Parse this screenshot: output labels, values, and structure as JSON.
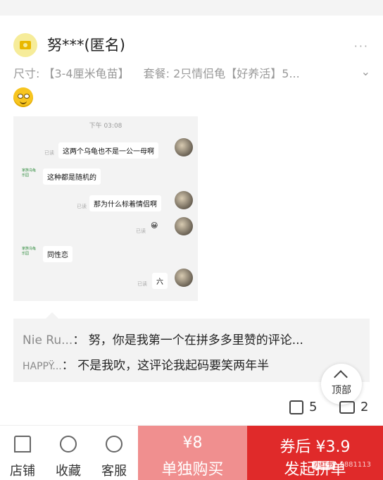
{
  "review": {
    "username": "努***(匿名)",
    "more": "···",
    "spec_size": "尺寸: 【3-4厘米龟苗】",
    "spec_package": "套餐: 2只情侣龟【好养活】5...",
    "emoji": "smiling-face-emoji",
    "screenshot": {
      "time": "下午 03:08",
      "messages": [
        {
          "side": "right",
          "text": "这两个乌龟也不是一公一母啊",
          "read": "已读"
        },
        {
          "side": "left",
          "text": "这种都是随机的",
          "shop": "家族乌龟乐园"
        },
        {
          "side": "right",
          "text": "那为什么标着情侣啊",
          "read": "已读"
        },
        {
          "side": "right",
          "text": "😀",
          "read": "已读"
        },
        {
          "side": "left",
          "text": "同性恋",
          "shop": "家族乌龟乐园"
        },
        {
          "side": "right",
          "text": "六",
          "read": "已读"
        }
      ]
    }
  },
  "replies": [
    {
      "name": "Nie Ru...",
      "text": "努，你是我第一个在拼多多里赞的评论..."
    },
    {
      "name": "HAPPŸ...",
      "text": "不是我吹，这评论我起码要笑两年半"
    }
  ],
  "to_top": "顶部",
  "stats": {
    "likes": "5",
    "comments": "2"
  },
  "bottom_bar": {
    "store": "店铺",
    "favorite": "收藏",
    "service": "客服",
    "single_price": "¥8",
    "single_label": "单独购买",
    "group_price": "券后 ¥3.9",
    "group_label": "发起拼单",
    "watermark_brand": "小红书",
    "watermark_id": "2881113"
  },
  "colors": {
    "primary": "#e02a2a",
    "secondary": "#f08f8f"
  }
}
